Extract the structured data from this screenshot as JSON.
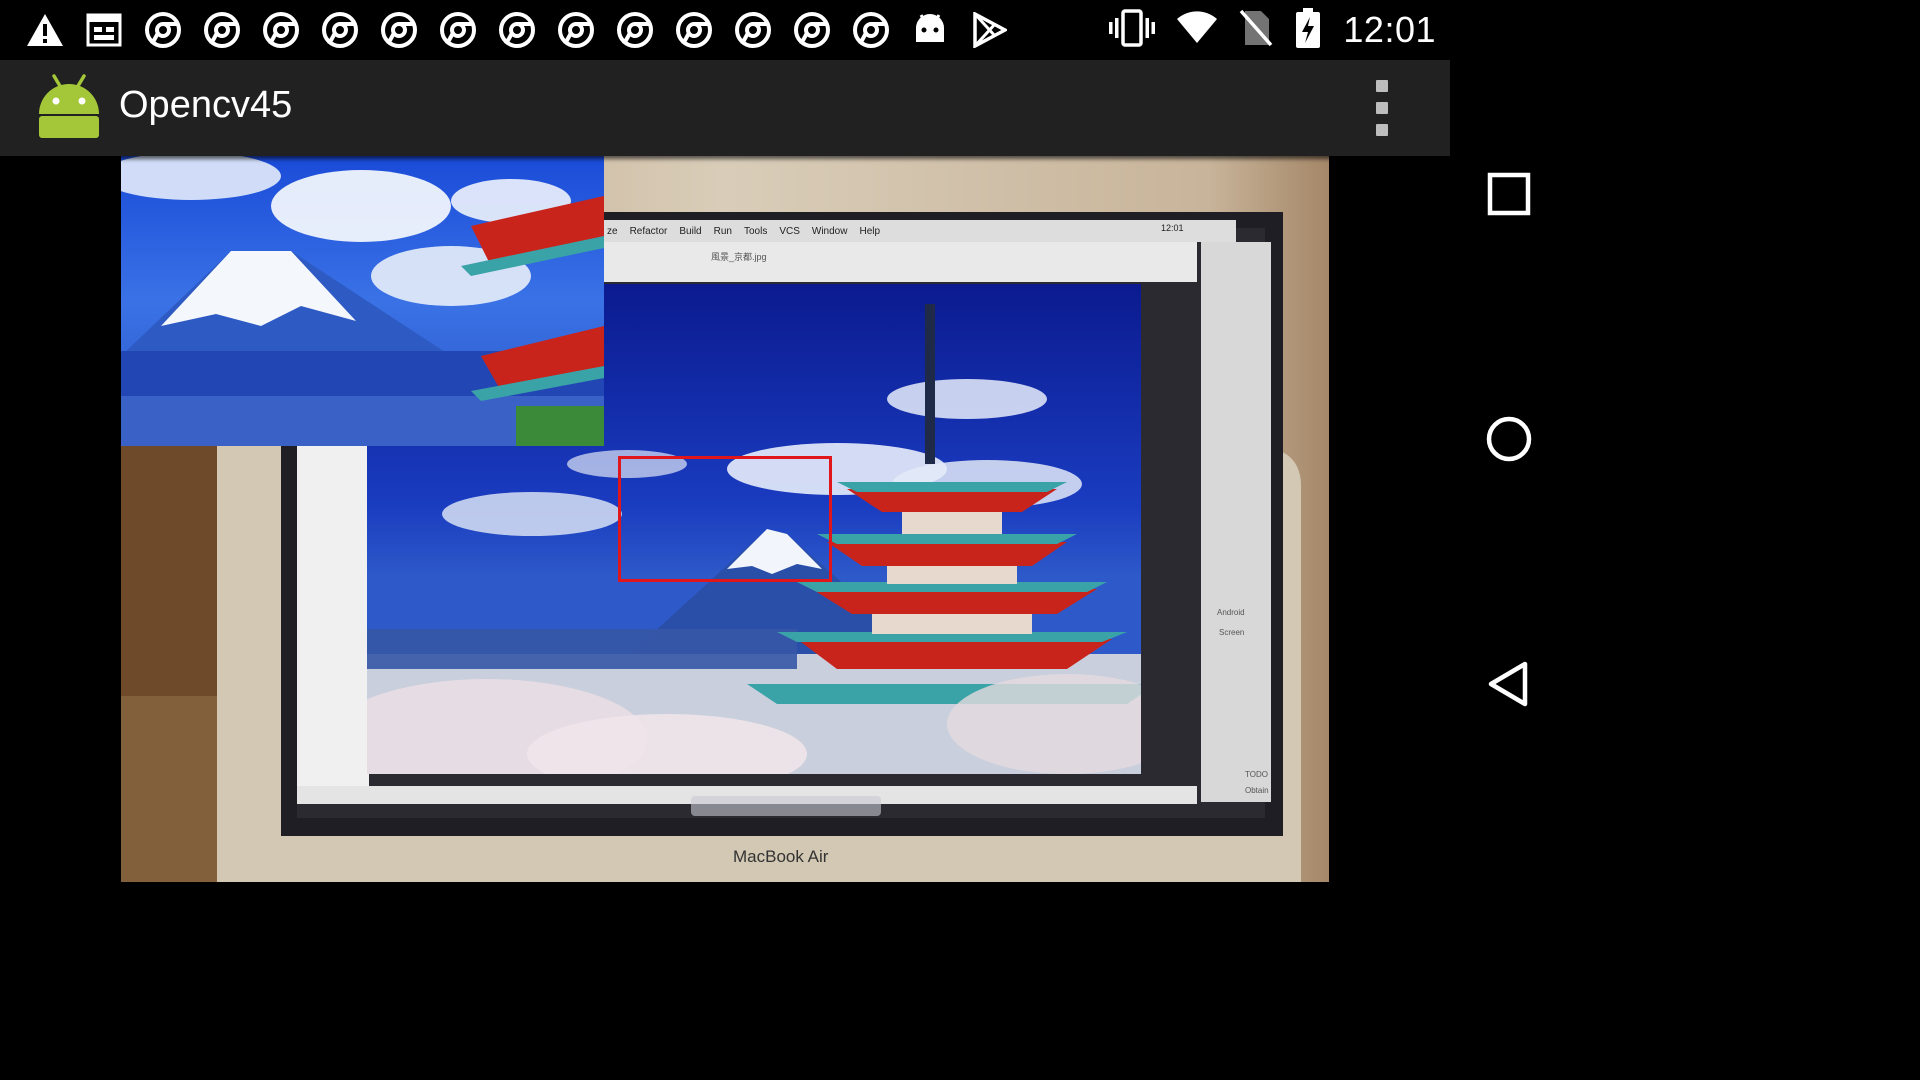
{
  "status_bar": {
    "left_icons": [
      "warning-icon",
      "calendar-icon",
      "chrome-icon",
      "chrome-icon",
      "chrome-icon",
      "chrome-icon",
      "chrome-icon",
      "chrome-icon",
      "chrome-icon",
      "chrome-icon",
      "chrome-icon",
      "chrome-icon",
      "chrome-icon",
      "chrome-icon",
      "chrome-icon",
      "android-debug-icon",
      "play-store-icon"
    ],
    "right_icons": [
      "vibrate-icon",
      "wifi-icon",
      "no-sim-icon",
      "battery-charging-icon"
    ],
    "time": "12:01"
  },
  "action_bar": {
    "title": "Opencv45",
    "app_icon": "android-icon",
    "overflow_icon": "more-vert-icon"
  },
  "camera_view": {
    "mac_menu": [
      "Refactor",
      "Build",
      "Run",
      "Tools",
      "VCS",
      "Window",
      "Help"
    ],
    "mac_menu_prefix": "ze",
    "mac_time": "12:01",
    "ide_file_title": "風景_京都.jpg",
    "ide_side_labels": [
      "Android",
      "Screen",
      "TODO",
      "Obtain"
    ],
    "laptop_brand": "MacBook Air",
    "roi_color": "#e0161b"
  },
  "nav_bar": {
    "buttons": [
      {
        "name": "recents",
        "icon": "recents-square-icon"
      },
      {
        "name": "home",
        "icon": "home-circle-icon"
      },
      {
        "name": "back",
        "icon": "back-triangle-icon"
      }
    ]
  },
  "colors": {
    "status_bar_bg": "#000000",
    "action_bar_bg": "#212121",
    "android_green": "#a4c639",
    "roi_red": "#e0161b"
  }
}
